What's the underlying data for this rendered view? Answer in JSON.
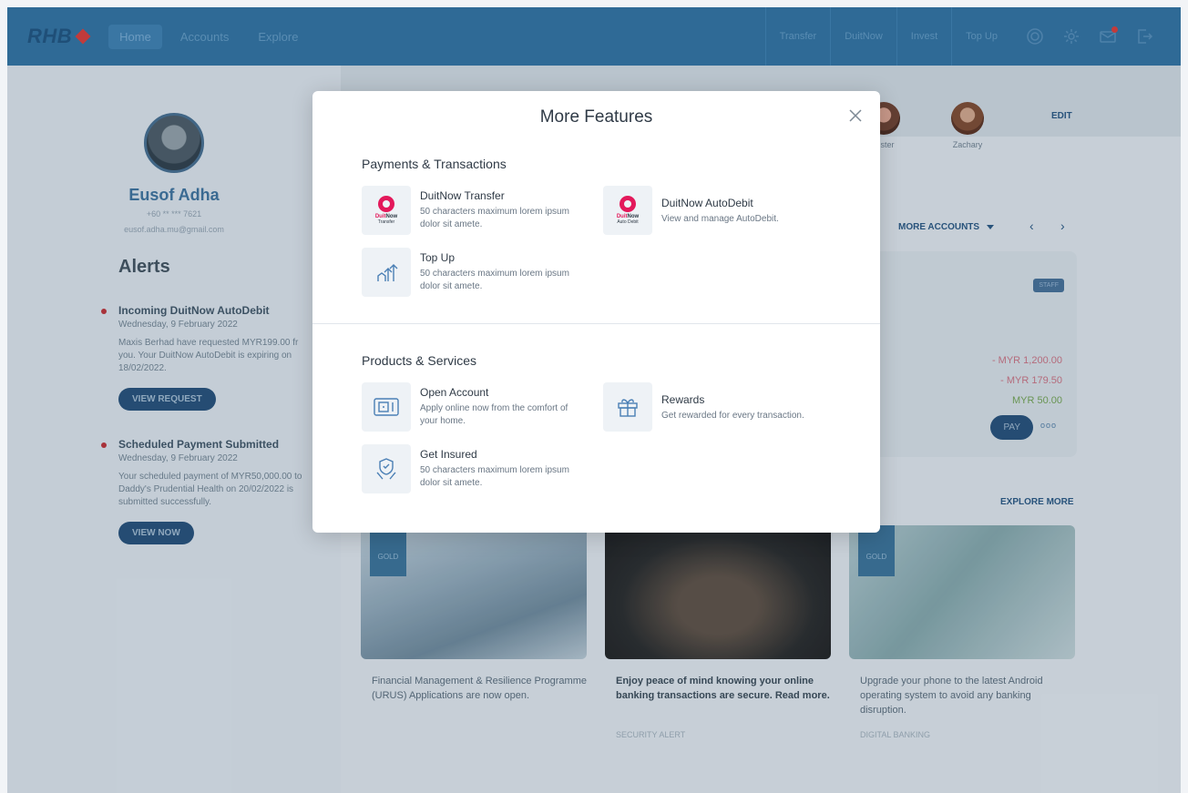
{
  "topbar": {
    "logo": "RHB",
    "nav": [
      "Home",
      "Accounts",
      "Explore"
    ],
    "quick_links": [
      "Transfer",
      "DuitNow",
      "Invest",
      "Top Up"
    ],
    "icons": [
      "support-icon",
      "settings-icon",
      "mail-icon",
      "logout-icon"
    ]
  },
  "profile": {
    "name": "Eusof Adha",
    "phone": "+60 ** *** 7621",
    "email": "eusof.adha.mu@gmail.com"
  },
  "alerts": {
    "title": "Alerts",
    "items": [
      {
        "title": "Incoming DuitNow AutoDebit",
        "date": "Wednesday, 9 February 2022",
        "body": "Maxis Berhad have requested MYR199.00 fr you. Your DuitNow AutoDebit is expiring on 18/02/2022.",
        "button": "VIEW REQUEST"
      },
      {
        "title": "Scheduled Payment Submitted",
        "date": "Wednesday, 9 February 2022",
        "body": "Your scheduled payment of MYR50,000.00 to Daddy's Prudential Health on 20/02/2022 is submitted successfully.",
        "button": "VIEW NOW"
      }
    ]
  },
  "favourites": [
    "Sister",
    "Zachary"
  ],
  "edit_label": "EDIT",
  "more_accounts": "MORE ACCOUNTS",
  "account_card": {
    "badge": "STAFF",
    "amounts": [
      "- MYR 1,200.00",
      "- MYR 179.50",
      "MYR 50.00"
    ],
    "pay": "PAY"
  },
  "explore_more": "EXPLORE MORE",
  "promos": [
    {
      "tag": "GOLD",
      "text": "Financial Management & Resilience Programme (URUS) Applications are now open.",
      "category": ""
    },
    {
      "tag": "",
      "text": "Enjoy peace of mind knowing your online banking transactions are secure. Read more.",
      "category": "SECURITY ALERT"
    },
    {
      "tag": "GOLD",
      "text": "Upgrade your phone to the latest Android operating system to avoid any banking disruption.",
      "category": "DIGITAL BANKING"
    }
  ],
  "modal": {
    "title": "More Features",
    "sections": [
      {
        "title": "Payments & Transactions",
        "features": [
          {
            "title": "DuitNow Transfer",
            "desc": "50 characters maximum lorem ipsum dolor sit amete.",
            "icon": "duitnow-transfer-icon",
            "icon_text": "Transfer"
          },
          {
            "title": "DuitNow AutoDebit",
            "desc": "View and manage AutoDebit.",
            "icon": "duitnow-autodebit-icon",
            "icon_text": "Auto Debit"
          },
          {
            "title": "Top Up",
            "desc": "50 characters maximum lorem ipsum dolor sit amete.",
            "icon": "top-up-icon"
          }
        ]
      },
      {
        "title": "Products & Services",
        "features": [
          {
            "title": "Open Account",
            "desc": "Apply online now from the comfort of your home.",
            "icon": "open-account-icon"
          },
          {
            "title": "Rewards",
            "desc": "Get rewarded for every transaction.",
            "icon": "gift-icon"
          },
          {
            "title": "Get Insured",
            "desc": "50 characters maximum lorem ipsum dolor sit amete.",
            "icon": "insurance-icon"
          }
        ]
      }
    ]
  }
}
